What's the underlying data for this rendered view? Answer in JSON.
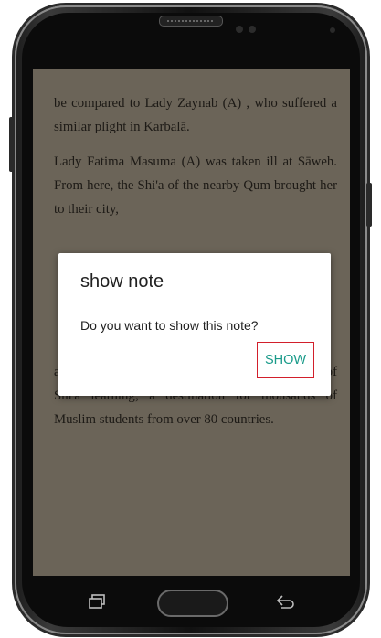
{
  "book": {
    "paragraph_1": "be compared to Lady Zaynab (A) , who suffered a similar plight in Karbalā.",
    "paragraph_2": "Lady Fatima Masuma (A) was taken ill at Sāweh. From here, the Shi'a of the nearby Qum brought her to their city,",
    "paragraph_3": "and patronage, the city has grown into a centre of Shi'a learning; a destination for thousands of Muslim students from over 80 countries."
  },
  "dialog": {
    "title": "show note",
    "message": "Do you want to show this note?",
    "button_label": "SHOW"
  },
  "icons": {
    "recent": "recent-apps-icon",
    "home": "home-button",
    "back": "back-icon"
  },
  "colors": {
    "accent": "#1a9b8a",
    "highlight": "#d21f2b",
    "scrim": "#6b6458"
  }
}
